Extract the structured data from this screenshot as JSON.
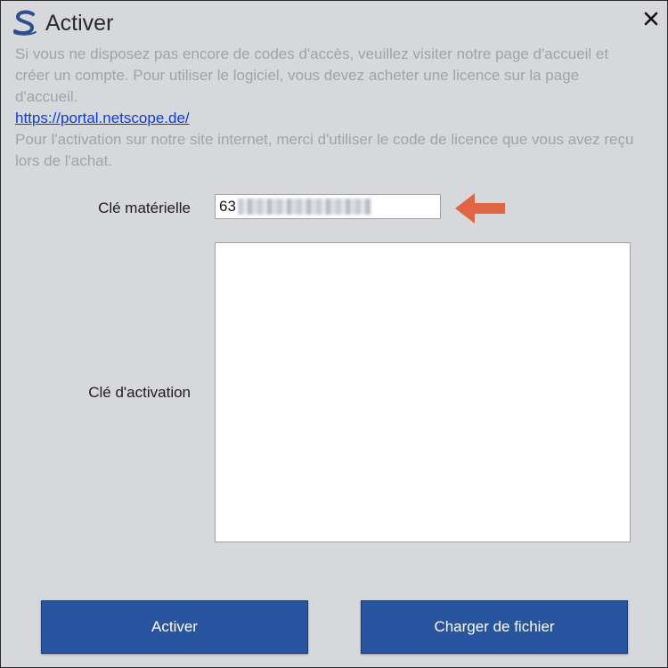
{
  "window": {
    "title": "Activer",
    "close_icon": "close-icon",
    "logo_icon": "app-logo-icon"
  },
  "info": {
    "paragraph1": "Si vous ne disposez pas encore de codes d'accès, veuillez visiter notre page d'accueil et créer un compte. Pour utiliser le logiciel, vous devez acheter une licence sur la page d'accueil.",
    "link": "https://portal.netscope.de/",
    "paragraph2": "Pour l'activation sur notre site internet, merci d'utiliser le code de licence que vous avez reçu lors de l'achat."
  },
  "form": {
    "hardware_key_label": "Clé matérielle",
    "hardware_key_value": "63",
    "activation_key_label": "Clé d'activation",
    "activation_key_value": ""
  },
  "buttons": {
    "activate": "Activer",
    "load_file": "Charger de fichier"
  },
  "colors": {
    "button_bg": "#2854a0",
    "arrow": "#e06643",
    "link": "#0b3fd1",
    "info_text": "#a1a3a9",
    "background": "#d7d8dc"
  }
}
